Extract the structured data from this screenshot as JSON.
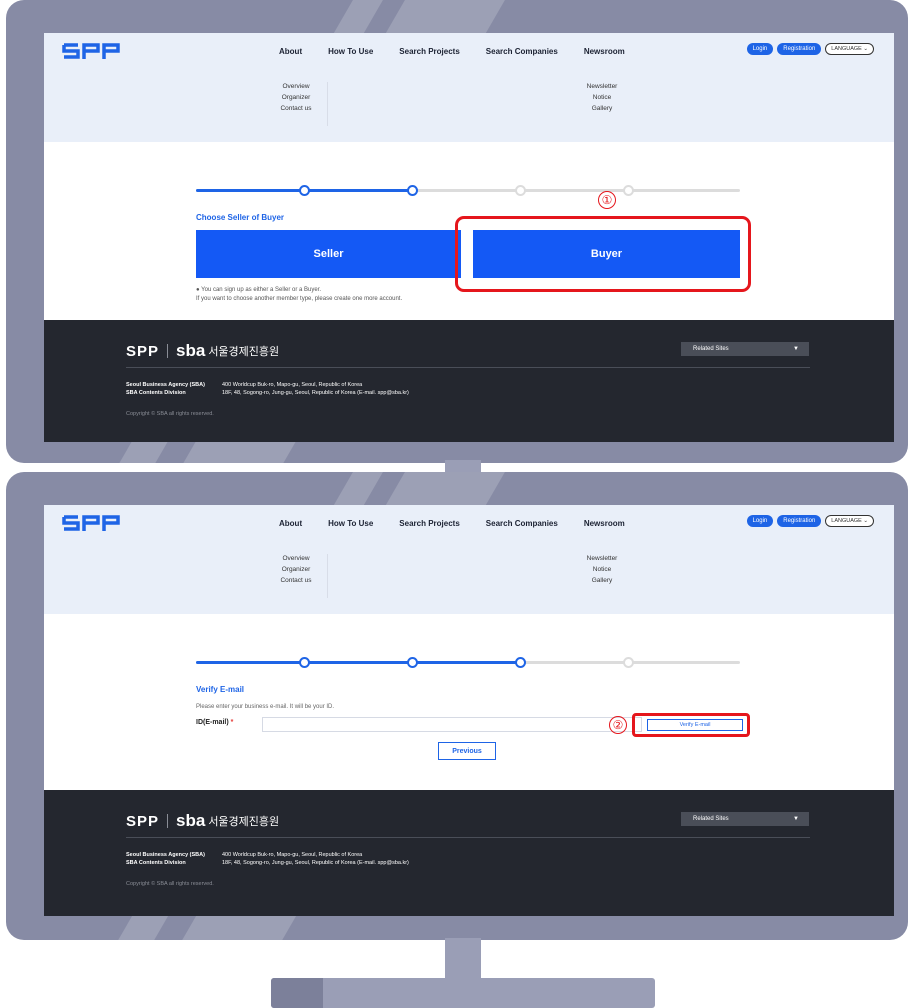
{
  "site": {
    "logo": "SPP",
    "nav": [
      "About",
      "How To Use",
      "Search Projects",
      "Search Companies",
      "Newsroom"
    ],
    "login": "Login",
    "registration": "Registration",
    "language": "LANGUAGE",
    "submenu_about": [
      "Overview",
      "Organizer",
      "Contact us"
    ],
    "submenu_newsroom": [
      "Newsletter",
      "Notice",
      "Gallery"
    ]
  },
  "screen1": {
    "section_title": "Choose Seller of Buyer",
    "seller": "Seller",
    "buyer": "Buyer",
    "note_line1": "● You can sign up as either a Seller or a Buyer.",
    "note_line2": "If you want to choose another member type, please create one more account.",
    "step_progress": 0.5,
    "annotation": "①"
  },
  "screen2": {
    "section_title": "Verify E-mail",
    "description": "Please enter your business e-mail. It will be your ID.",
    "field_label": "ID(E-mail)",
    "required_mark": "*",
    "verify_button": "Verify E-mail",
    "previous_button": "Previous",
    "step_progress": 0.75,
    "annotation": "②"
  },
  "footer": {
    "spp": "SPP",
    "sba": "sba",
    "sba_korean": "서울경제진흥원",
    "related_sites": "Related Sites",
    "org1_name": "Seoul Business Agency (SBA)",
    "org1_addr": "400 Worldcup Buk-ro, Mapo-gu, Seoul, Republic of Korea",
    "org2_name": "SBA Contents Division",
    "org2_addr": "18F, 48, Sogong-ro, Jung-gu, Seoul, Republic of Korea (E-mail. spp@sba.kr)",
    "copyright": "Copyright © SBA all rights reserved."
  },
  "colors": {
    "accent": "#1e64e6",
    "button_blue": "#1459f5",
    "annotation_red": "#e5161c",
    "footer_bg": "#24272f",
    "monitor_frame": "#878ba5"
  }
}
